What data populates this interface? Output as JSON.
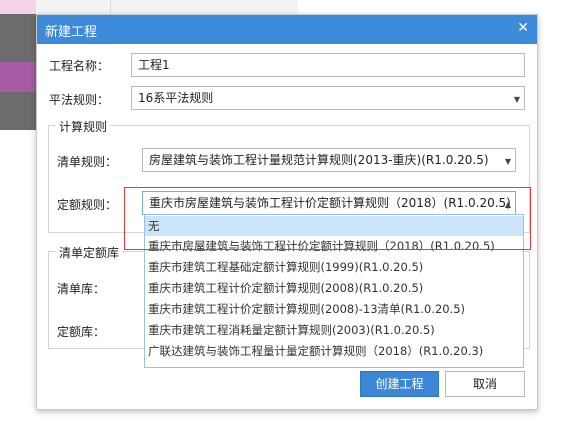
{
  "dialog": {
    "title": "新建工程",
    "project_name_label": "工程名称：",
    "project_name_value": "工程1",
    "pingfa_label": "平法规则：",
    "pingfa_value": "16系平法规则",
    "calc_group_title": "计算规则",
    "qingdan_rule_label": "清单规则：",
    "qingdan_rule_value": "房屋建筑与装饰工程计量规范计算规则(2013-重庆)(R1.0.20.5)",
    "dinge_rule_label": "定额规则：",
    "dinge_rule_value": "重庆市房屋建筑与装饰工程计价定额计算规则（2018）(R1.0.20.5)",
    "lib_group_title": "清单定额库",
    "qingdan_lib_label": "清单库：",
    "dinge_lib_label": "定额库：",
    "create_button": "创建工程",
    "cancel_button": "取消"
  },
  "dropdown": {
    "items": [
      "无",
      "重庆市房屋建筑与装饰工程计价定额计算规则（2018）(R1.0.20.5)",
      "重庆市建筑工程基础定额计算规则(1999)(R1.0.20.5)",
      "重庆市建筑工程计价定额计算规则(2008)(R1.0.20.5)",
      "重庆市建筑工程计价定额计算规则(2008)-13清单(R1.0.20.5)",
      "重庆市建筑工程消耗量定额计算规则(2003)(R1.0.20.5)",
      "广联达建筑与装饰工程量计量定额计算规则（2018）(R1.0.20.3)"
    ],
    "selected_index": 0
  },
  "colors": {
    "titlebar": "#3c8ad9",
    "primary_button": "#3b87d6",
    "selected_item": "#cce4f7",
    "highlight_border": "#e43a3a"
  }
}
